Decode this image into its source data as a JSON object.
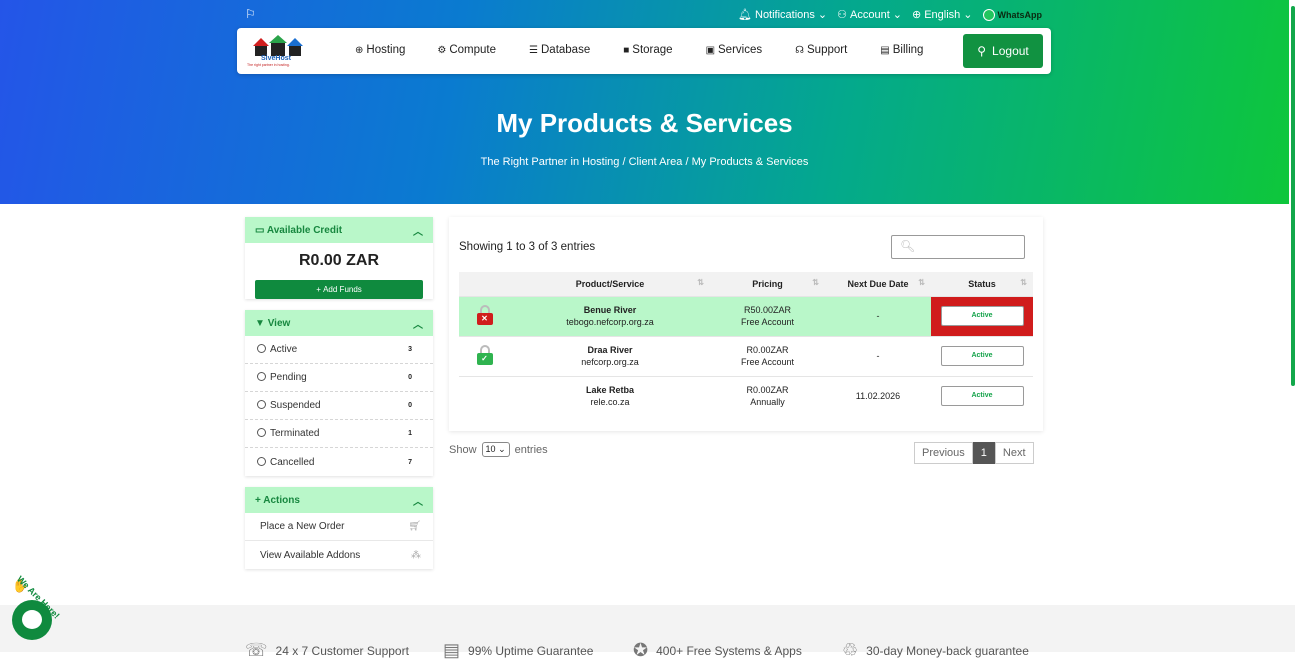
{
  "topbar": {
    "flag_icon": "flag-icon",
    "notifications": "Notifications",
    "account": "Account",
    "language": "English",
    "whatsapp": "WhatsApp"
  },
  "logo": {
    "brand": "SiveHost",
    "tagline": "The right partner in hosting."
  },
  "nav": {
    "items": [
      {
        "label": "Hosting",
        "icon": "globe-icon"
      },
      {
        "label": "Compute",
        "icon": "gear-icon"
      },
      {
        "label": "Database",
        "icon": "database-icon"
      },
      {
        "label": "Storage",
        "icon": "box-icon"
      },
      {
        "label": "Services",
        "icon": "gift-icon"
      },
      {
        "label": "Support",
        "icon": "headset-icon"
      },
      {
        "label": "Billing",
        "icon": "receipt-icon"
      }
    ],
    "logout": "Logout"
  },
  "header": {
    "title": "My Products & Services",
    "breadcrumb": [
      "The Right Partner in Hosting",
      "Client Area",
      "My Products & Services"
    ]
  },
  "sidebar": {
    "credit": {
      "title": "Available Credit",
      "amount": "R0.00 ZAR",
      "add_funds": "Add Funds"
    },
    "view": {
      "title": "View",
      "items": [
        {
          "label": "Active",
          "count": "3"
        },
        {
          "label": "Pending",
          "count": "0"
        },
        {
          "label": "Suspended",
          "count": "0"
        },
        {
          "label": "Terminated",
          "count": "1"
        },
        {
          "label": "Cancelled",
          "count": "7"
        }
      ]
    },
    "actions": {
      "title": "Actions",
      "items": [
        {
          "label": "Place a New Order",
          "icon": "cart-icon"
        },
        {
          "label": "View Available Addons",
          "icon": "cubes-icon"
        }
      ]
    }
  },
  "table": {
    "showing": "Showing 1 to 3 of 3 entries",
    "search_placeholder": "",
    "headers": [
      "Product/Service",
      "Pricing",
      "Next Due Date",
      "Status"
    ],
    "rows": [
      {
        "name": "Benue River",
        "domain": "tebogo.nefcorp.org.za",
        "price": "R50.00ZAR",
        "cycle": "Free Account",
        "due": "-",
        "status": "Active",
        "lock": "red"
      },
      {
        "name": "Draa River",
        "domain": "nefcorp.org.za",
        "price": "R0.00ZAR",
        "cycle": "Free Account",
        "due": "-",
        "status": "Active",
        "lock": "green"
      },
      {
        "name": "Lake Retba",
        "domain": "rele.co.za",
        "price": "R0.00ZAR",
        "cycle": "Annually",
        "due": "11.02.2026",
        "status": "Active",
        "lock": "none"
      }
    ],
    "show_label": "Show",
    "page_size": "10",
    "entries_label": "entries",
    "pager": {
      "previous": "Previous",
      "current": "1",
      "next": "Next"
    }
  },
  "footer": {
    "features": [
      "24 x 7 Customer Support",
      "99% Uptime Guarantee",
      "400+ Free Systems & Apps",
      "30-day Money-back guarantee"
    ]
  },
  "chat": {
    "label": "We Are Here!"
  },
  "colors": {
    "accent_green": "#119241",
    "highlight_green": "#b9f7c9",
    "highlight_red": "#d01c1c"
  }
}
